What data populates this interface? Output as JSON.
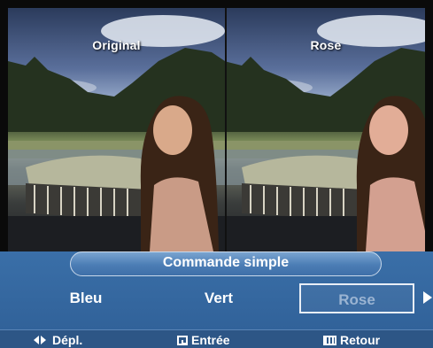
{
  "preview": {
    "left_label": "Original",
    "right_label": "Rose"
  },
  "menu": {
    "title": "Commande simple",
    "options": [
      "Bleu",
      "Vert",
      "Rose"
    ],
    "selected": "Rose",
    "more_icon": "arrow-right-icon"
  },
  "footer": {
    "move_icon": "left-right-arrows-icon",
    "move_label": "Dépl.",
    "enter_icon": "enter-icon",
    "enter_label": "Entrée",
    "return_icon": "menu-icon",
    "return_label": "Retour"
  },
  "colors": {
    "menu_background": "#3a6fa8",
    "title_bar": "#4b7db5",
    "selected_border": "#e8eef6",
    "selected_text": "#9bb4d2"
  }
}
